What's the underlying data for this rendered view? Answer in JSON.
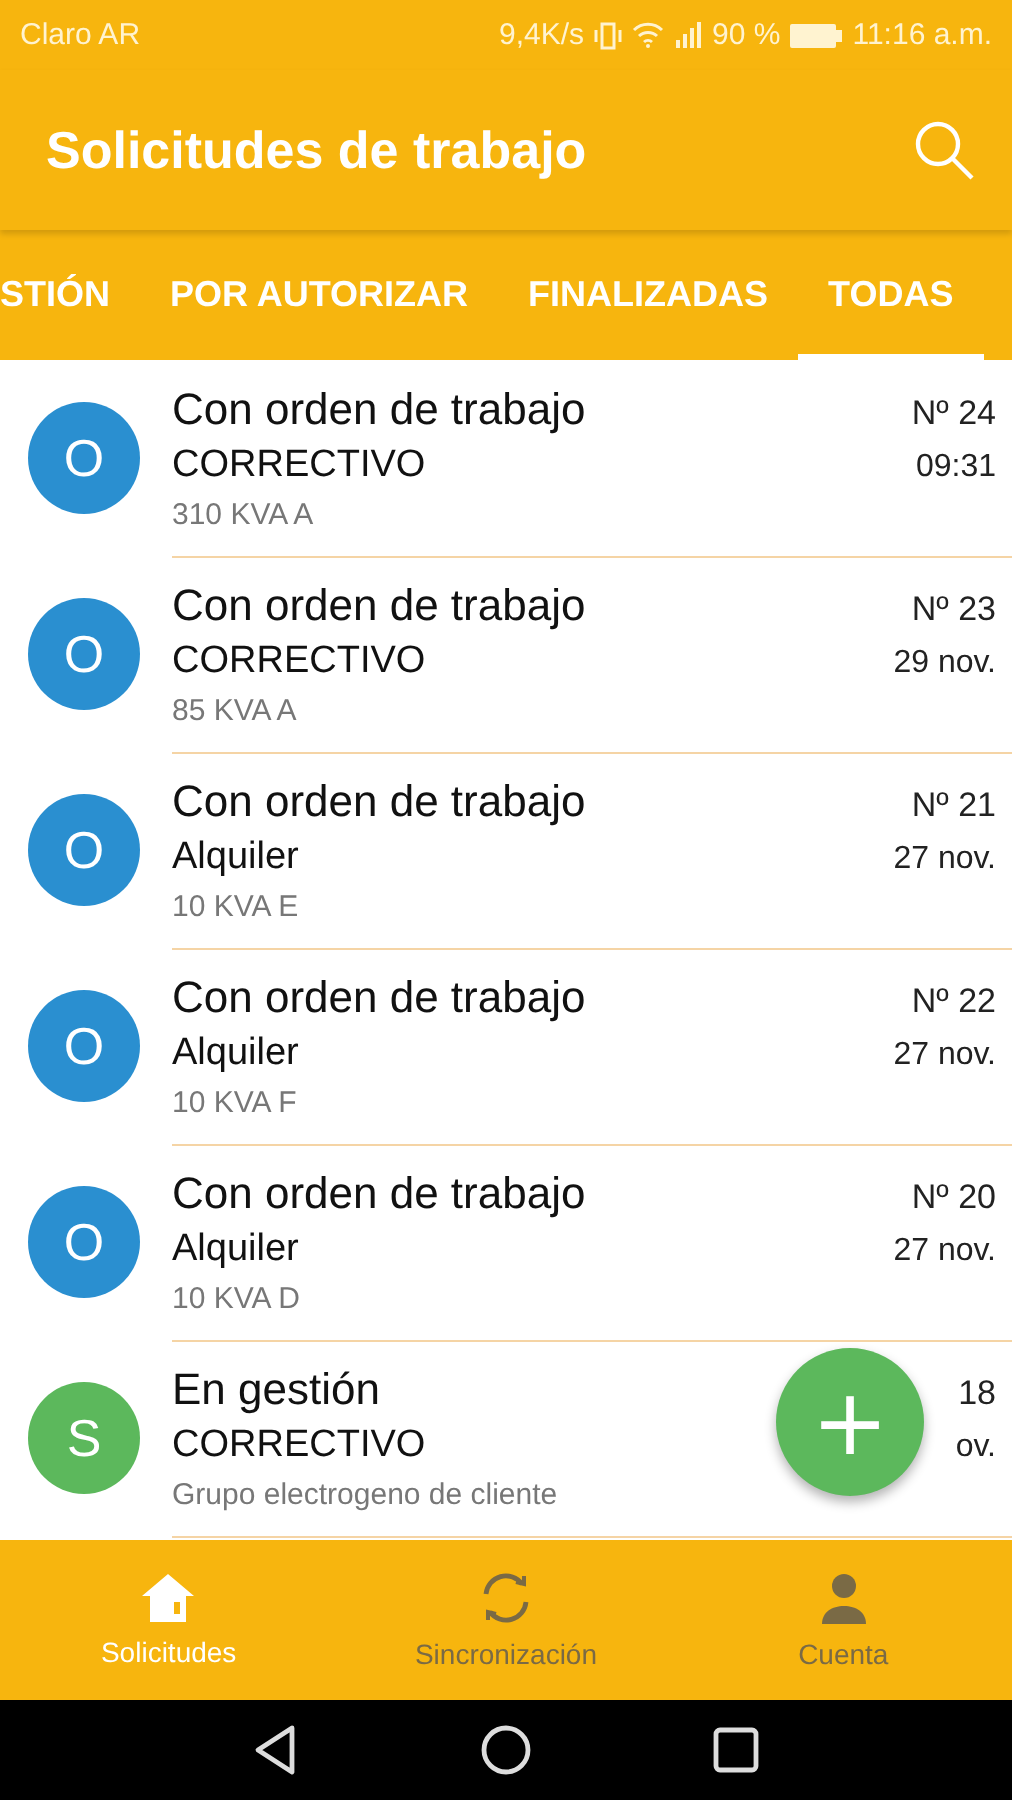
{
  "status_bar": {
    "carrier": "Claro AR",
    "speed": "9,4K/s",
    "battery": "90 %",
    "time": "11:16 a.m."
  },
  "app_bar": {
    "title": "Solicitudes de trabajo"
  },
  "tabs": [
    {
      "label": "STIÓN",
      "selected": false
    },
    {
      "label": "POR AUTORIZAR",
      "selected": false
    },
    {
      "label": "FINALIZADAS",
      "selected": false
    },
    {
      "label": "TODAS",
      "selected": true
    }
  ],
  "requests": [
    {
      "initial": "O",
      "color": "#2a8fd0",
      "title": "Con orden de trabajo",
      "type": "CORRECTIVO",
      "detail": "310 KVA A",
      "number": "Nº 24",
      "date": "09:31"
    },
    {
      "initial": "O",
      "color": "#2a8fd0",
      "title": "Con orden de trabajo",
      "type": "CORRECTIVO",
      "detail": "85 KVA A",
      "number": "Nº 23",
      "date": "29 nov."
    },
    {
      "initial": "O",
      "color": "#2a8fd0",
      "title": "Con orden de trabajo",
      "type": "Alquiler",
      "detail": "10 KVA E",
      "number": "Nº 21",
      "date": "27 nov."
    },
    {
      "initial": "O",
      "color": "#2a8fd0",
      "title": "Con orden de trabajo",
      "type": "Alquiler",
      "detail": "10 KVA F",
      "number": "Nº 22",
      "date": "27 nov."
    },
    {
      "initial": "O",
      "color": "#2a8fd0",
      "title": "Con orden de trabajo",
      "type": "Alquiler",
      "detail": "10 KVA D",
      "number": "Nº 20",
      "date": "27 nov."
    },
    {
      "initial": "S",
      "color": "#5cb85c",
      "title": "En gestión",
      "type": "CORRECTIVO",
      "detail": "Grupo electrogeno de cliente",
      "number": "18",
      "date": "ov."
    }
  ],
  "fab": {
    "label": "+"
  },
  "bottom_nav": [
    {
      "kind": "home",
      "label": "Solicitudes",
      "selected": true
    },
    {
      "kind": "sync",
      "label": "Sincronización",
      "selected": false
    },
    {
      "kind": "account",
      "label": "Cuenta",
      "selected": false
    }
  ]
}
